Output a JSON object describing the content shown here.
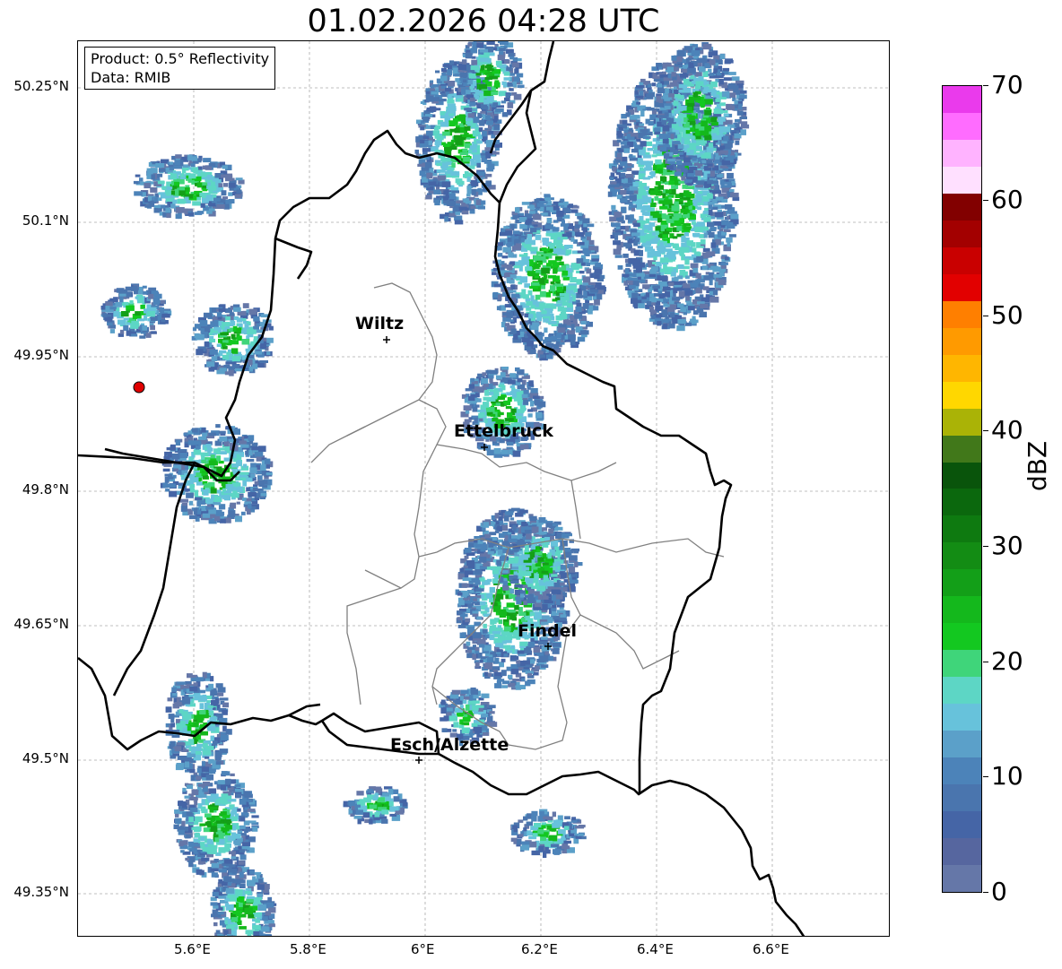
{
  "title": "01.02.2026 04:28 UTC",
  "info_box": {
    "product": "Product: 0.5° Reflectivity",
    "source": "Data: RMIB"
  },
  "map": {
    "lat_ticks": [
      "50.25°N",
      "50.1°N",
      "49.95°N",
      "49.8°N",
      "49.65°N",
      "49.5°N",
      "49.35°N"
    ],
    "lon_ticks": [
      "5.6°E",
      "5.8°E",
      "6°E",
      "6.2°E",
      "6.4°E",
      "6.6°E"
    ],
    "cities": [
      {
        "name": "Wiltz"
      },
      {
        "name": "Ettelbruck"
      },
      {
        "name": "Findel"
      },
      {
        "name": "Esch/Alzette"
      }
    ],
    "radar_site": "red-circle-marker",
    "grid": "dotted"
  },
  "colorbar": {
    "label": "dBZ",
    "ticks": [
      "0",
      "10",
      "20",
      "30",
      "40",
      "50",
      "60",
      "70"
    ],
    "colors": [
      "#6577a8",
      "#56669f",
      "#4565a6",
      "#4a75ae",
      "#4c83b9",
      "#5ba0c9",
      "#67c2db",
      "#5dd6c5",
      "#3fd57a",
      "#13c820",
      "#14b81c",
      "#139f18",
      "#138c14",
      "#0e7a10",
      "#0b680d",
      "#09540b",
      "#41781a",
      "#aab306",
      "#ffd700",
      "#ffb600",
      "#ff9a00",
      "#ff7f00",
      "#e20000",
      "#c90000",
      "#a30000",
      "#820000",
      "#ffe0ff",
      "#ffb3ff",
      "#ff6cff",
      "#ea3aec"
    ]
  }
}
